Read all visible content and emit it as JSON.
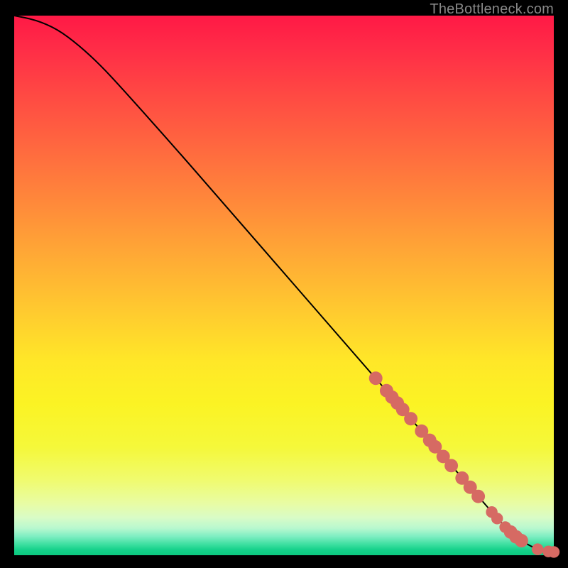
{
  "attribution": "TheBottleneck.com",
  "colors": {
    "page_bg": "#000000",
    "attribution_text": "#888888",
    "curve_stroke": "#000000",
    "marker_fill": "#d66a63",
    "marker_stroke": "#d66a63",
    "gradient_stops": [
      {
        "pos": 0.0,
        "hex": "#ff1946"
      },
      {
        "pos": 0.5,
        "hex": "#ffc22f"
      },
      {
        "pos": 0.8,
        "hex": "#f5f83a"
      },
      {
        "pos": 1.0,
        "hex": "#0bc97f"
      }
    ]
  },
  "chart_data": {
    "type": "line",
    "title": "",
    "xlabel": "",
    "ylabel": "",
    "xlim": [
      0,
      100
    ],
    "ylim": [
      0,
      100
    ],
    "grid": false,
    "legend": false,
    "series": [
      {
        "name": "curve",
        "x": [
          0,
          4,
          8,
          12,
          16,
          20,
          30,
          40,
          50,
          60,
          70,
          80,
          86,
          90,
          92,
          94,
          96,
          98,
          100
        ],
        "y": [
          100,
          99.2,
          97.5,
          94.5,
          90.8,
          86.5,
          75.3,
          63.8,
          52.3,
          40.8,
          29.3,
          17.8,
          10.9,
          6.3,
          4.3,
          2.7,
          1.5,
          0.8,
          0.6
        ]
      }
    ],
    "markers": [
      {
        "x": 67,
        "y": 32.8,
        "r": 1.5
      },
      {
        "x": 69,
        "y": 30.5,
        "r": 1.5
      },
      {
        "x": 70,
        "y": 29.3,
        "r": 1.5
      },
      {
        "x": 71,
        "y": 28.2,
        "r": 1.5
      },
      {
        "x": 72,
        "y": 27.0,
        "r": 1.5
      },
      {
        "x": 73.5,
        "y": 25.3,
        "r": 1.5
      },
      {
        "x": 75.5,
        "y": 23.0,
        "r": 1.5
      },
      {
        "x": 77,
        "y": 21.3,
        "r": 1.5
      },
      {
        "x": 78,
        "y": 20.1,
        "r": 1.5
      },
      {
        "x": 79.5,
        "y": 18.3,
        "r": 1.5
      },
      {
        "x": 81,
        "y": 16.6,
        "r": 1.5
      },
      {
        "x": 83,
        "y": 14.3,
        "r": 1.5
      },
      {
        "x": 84.5,
        "y": 12.6,
        "r": 1.5
      },
      {
        "x": 86,
        "y": 10.9,
        "r": 1.5
      },
      {
        "x": 88.5,
        "y": 8.0,
        "r": 1.2
      },
      {
        "x": 89.5,
        "y": 6.8,
        "r": 1.2
      },
      {
        "x": 91,
        "y": 5.2,
        "r": 1.2
      },
      {
        "x": 92,
        "y": 4.3,
        "r": 1.5
      },
      {
        "x": 93,
        "y": 3.4,
        "r": 1.5
      },
      {
        "x": 94,
        "y": 2.7,
        "r": 1.5
      },
      {
        "x": 97,
        "y": 1.1,
        "r": 1.2
      },
      {
        "x": 99,
        "y": 0.7,
        "r": 1.2
      },
      {
        "x": 100,
        "y": 0.6,
        "r": 1.2
      }
    ]
  }
}
